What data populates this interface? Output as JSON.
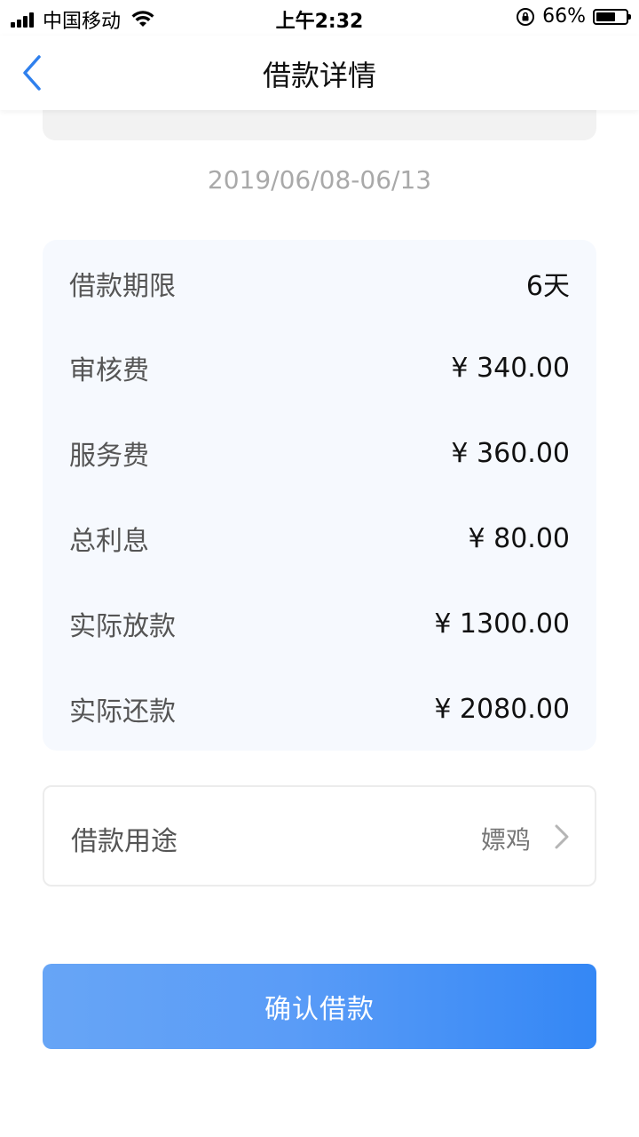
{
  "status_bar": {
    "carrier": "中国移动",
    "time": "上午2:32",
    "battery_percent": "66%",
    "battery_level": 0.66
  },
  "nav": {
    "title": "借款详情"
  },
  "date_range": "2019/06/08-06/13",
  "details": [
    {
      "label": "借款期限",
      "value": "6天"
    },
    {
      "label": "审核费",
      "value": "¥ 340.00"
    },
    {
      "label": "服务费",
      "value": "¥ 360.00"
    },
    {
      "label": "总利息",
      "value": "¥ 80.00"
    },
    {
      "label": "实际放款",
      "value": "¥ 1300.00"
    },
    {
      "label": "实际还款",
      "value": "¥ 2080.00"
    }
  ],
  "purpose": {
    "label": "借款用途",
    "value": "嫖鸡"
  },
  "confirm_button": {
    "label": "确认借款"
  },
  "colors": {
    "accent": "#3487f5",
    "back_arrow": "#2f80ed",
    "card_bg": "#f6f9fe"
  }
}
